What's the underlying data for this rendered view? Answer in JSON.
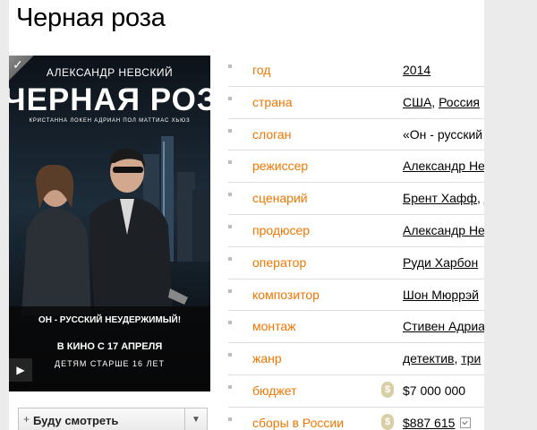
{
  "movie": {
    "title": "Черная роза"
  },
  "poster": {
    "director": "АЛЕКСАНДР НЕВСКИЙ",
    "title": "ЧЕРНАЯ РОЗА",
    "cast": "КРИСТАННА ЛОКЕН  АДРИАН ПОЛ  МАТТИАС ХЬЮЗ",
    "slogan": "ОН - РУССКИЙ НЕУДЕРЖИМЫЙ!",
    "release": "В КИНО С 17 АПРЕЛЯ",
    "age": "ДЕТЯМ СТАРШЕ 16 ЛЕТ"
  },
  "watch_button": {
    "label": "Буду смотреть"
  },
  "info_rows": [
    {
      "key": "год",
      "values": [
        {
          "text": "2014",
          "link": true
        }
      ]
    },
    {
      "key": "страна",
      "values": [
        {
          "text": "США",
          "link": true
        },
        {
          "text": ", ",
          "link": false
        },
        {
          "text": "Россия",
          "link": true
        }
      ]
    },
    {
      "key": "слоган",
      "values": [
        {
          "text": "«Он - русский",
          "link": false
        }
      ]
    },
    {
      "key": "режиссер",
      "values": [
        {
          "text": "Александр Нев",
          "link": true
        }
      ]
    },
    {
      "key": "сценарий",
      "values": [
        {
          "text": "Брент Хафф",
          "link": true
        },
        {
          "text": ", ",
          "link": false
        },
        {
          "text": "Д",
          "link": true
        }
      ]
    },
    {
      "key": "продюсер",
      "values": [
        {
          "text": "Александр Нев",
          "link": true
        }
      ]
    },
    {
      "key": "оператор",
      "values": [
        {
          "text": "Руди Харбон",
          "link": true
        }
      ]
    },
    {
      "key": "композитор",
      "values": [
        {
          "text": "Шон Мюррэй",
          "link": true
        }
      ]
    },
    {
      "key": "монтаж",
      "values": [
        {
          "text": "Стивен Адриан",
          "link": true
        }
      ]
    },
    {
      "key": "жанр",
      "values": [
        {
          "text": "детектив",
          "link": true
        },
        {
          "text": ", ",
          "link": false
        },
        {
          "text": "три",
          "link": true
        }
      ]
    },
    {
      "key": "бюджет",
      "money_icon": true,
      "values": [
        {
          "text": "$7 000 000",
          "link": false
        }
      ]
    },
    {
      "key": "сборы в России",
      "money_icon": true,
      "check_box": true,
      "values": [
        {
          "text": "$887 615",
          "link": true
        }
      ]
    }
  ]
}
